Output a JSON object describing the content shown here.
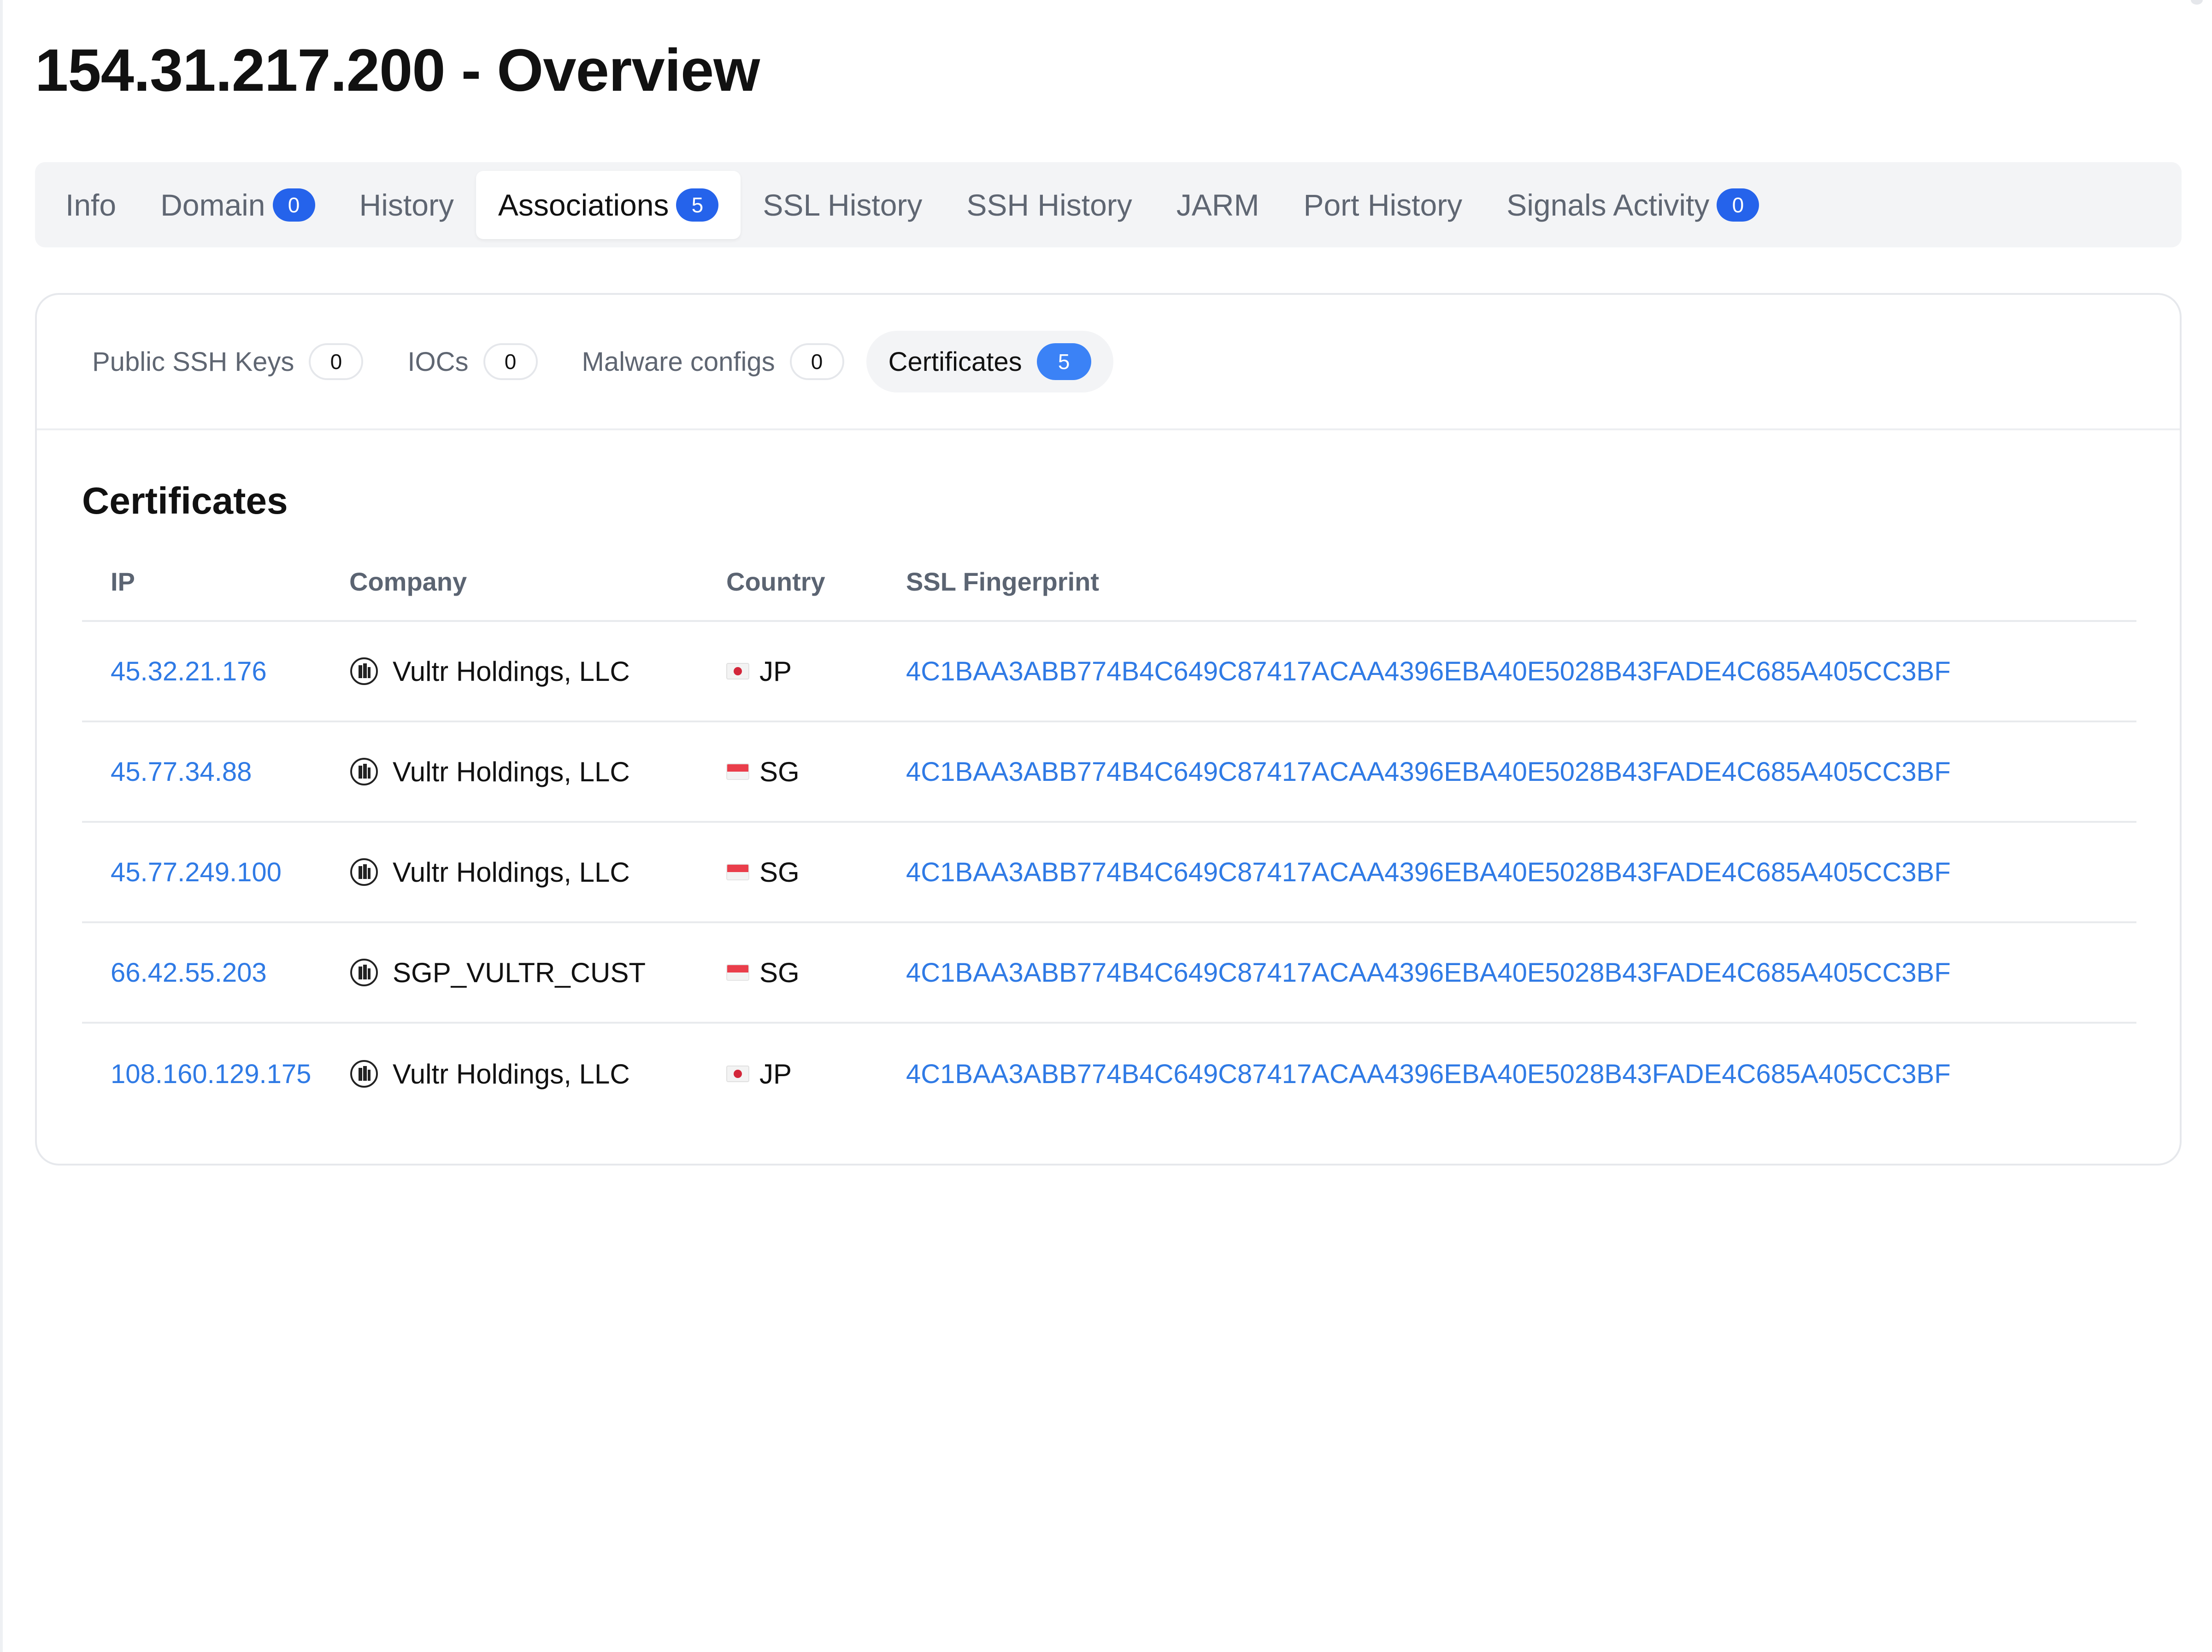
{
  "page": {
    "title": "154.31.217.200 - Overview"
  },
  "tabs": [
    {
      "label": "Info",
      "badge": null,
      "active": false
    },
    {
      "label": "Domain",
      "badge": "0",
      "active": false
    },
    {
      "label": "History",
      "badge": null,
      "active": false
    },
    {
      "label": "Associations",
      "badge": "5",
      "active": true
    },
    {
      "label": "SSL History",
      "badge": null,
      "active": false
    },
    {
      "label": "SSH History",
      "badge": null,
      "active": false
    },
    {
      "label": "JARM",
      "badge": null,
      "active": false
    },
    {
      "label": "Port History",
      "badge": null,
      "active": false
    },
    {
      "label": "Signals Activity",
      "badge": "0",
      "active": false
    }
  ],
  "subtabs": [
    {
      "label": "Public SSH Keys",
      "count": "0",
      "active": false
    },
    {
      "label": "IOCs",
      "count": "0",
      "active": false
    },
    {
      "label": "Malware configs",
      "count": "0",
      "active": false
    },
    {
      "label": "Certificates",
      "count": "5",
      "active": true
    }
  ],
  "certificates": {
    "title": "Certificates",
    "columns": {
      "ip": "IP",
      "company": "Company",
      "country": "Country",
      "fingerprint": "SSL Fingerprint"
    },
    "rows": [
      {
        "ip": "45.32.21.176",
        "company": "Vultr Holdings, LLC",
        "country": "JP",
        "fingerprint": "4C1BAA3ABB774B4C649C87417ACAA4396EBA40E5028B43FADE4C685A405CC3BF"
      },
      {
        "ip": "45.77.34.88",
        "company": "Vultr Holdings, LLC",
        "country": "SG",
        "fingerprint": "4C1BAA3ABB774B4C649C87417ACAA4396EBA40E5028B43FADE4C685A405CC3BF"
      },
      {
        "ip": "45.77.249.100",
        "company": "Vultr Holdings, LLC",
        "country": "SG",
        "fingerprint": "4C1BAA3ABB774B4C649C87417ACAA4396EBA40E5028B43FADE4C685A405CC3BF"
      },
      {
        "ip": "66.42.55.203",
        "company": "SGP_VULTR_CUST",
        "country": "SG",
        "fingerprint": "4C1BAA3ABB774B4C649C87417ACAA4396EBA40E5028B43FADE4C685A405CC3BF"
      },
      {
        "ip": "108.160.129.175",
        "company": "Vultr Holdings, LLC",
        "country": "JP",
        "fingerprint": "4C1BAA3ABB774B4C649C87417ACAA4396EBA40E5028B43FADE4C685A405CC3BF"
      }
    ]
  },
  "icons": {
    "company": "building-icon",
    "flag_jp": "japan-flag-icon",
    "flag_sg": "singapore-flag-icon"
  },
  "colors": {
    "accent": "#2563eb",
    "link": "#2f7ae5",
    "muted": "#5f6672"
  }
}
